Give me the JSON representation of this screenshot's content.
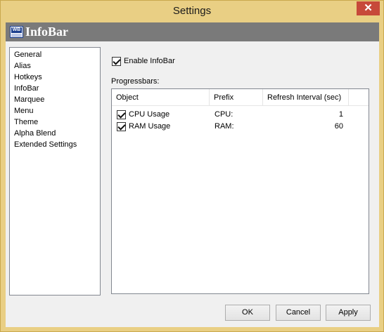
{
  "window": {
    "title": "Settings",
    "close_glyph": "✕"
  },
  "banner": {
    "title": "InfoBar",
    "logo_text": "WB",
    "logo_icon": "infobar-logo-icon"
  },
  "nav": {
    "items": [
      {
        "label": "General"
      },
      {
        "label": "Alias"
      },
      {
        "label": "Hotkeys"
      },
      {
        "label": "InfoBar"
      },
      {
        "label": "Marquee"
      },
      {
        "label": "Menu"
      },
      {
        "label": "Theme"
      },
      {
        "label": "Alpha Blend"
      },
      {
        "label": "Extended Settings"
      }
    ]
  },
  "enable_infobar": {
    "label": "Enable InfoBar",
    "checked": true
  },
  "progressbars": {
    "label": "Progressbars:",
    "columns": {
      "object": "Object",
      "prefix": "Prefix",
      "refresh": "Refresh Interval (sec)"
    },
    "rows": [
      {
        "object": "CPU Usage",
        "prefix": "CPU:",
        "refresh": "1",
        "checked": true
      },
      {
        "object": "RAM Usage",
        "prefix": "RAM:",
        "refresh": "60",
        "checked": true
      }
    ]
  },
  "buttons": {
    "ok": "OK",
    "cancel": "Cancel",
    "apply": "Apply"
  }
}
